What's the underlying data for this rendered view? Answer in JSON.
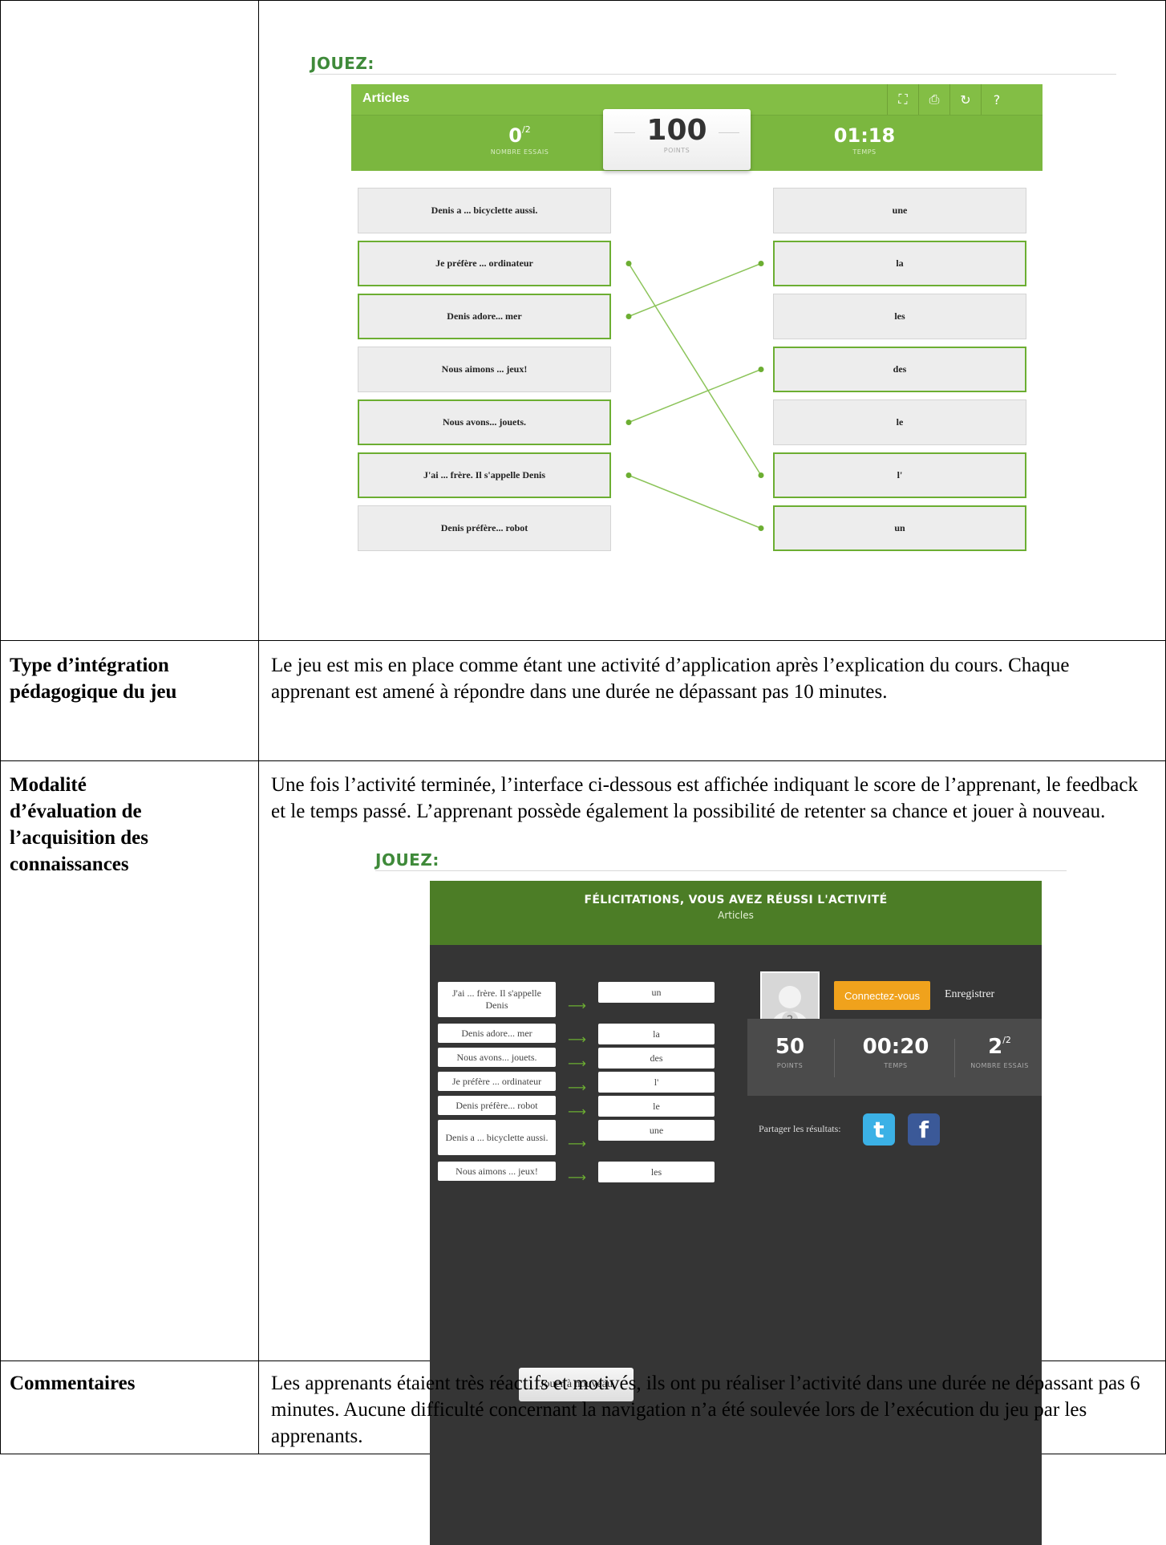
{
  "jouez_label": "JOUEZ:",
  "game": {
    "title": "Articles",
    "attempts_value": "0",
    "attempts_total": "/2",
    "attempts_caption": "NOMBRE ESSAIS",
    "points_value": "100",
    "points_caption": "POINTS",
    "time_value": "01:18",
    "time_caption": "TEMPS",
    "icons": [
      "fullscreen-icon",
      "print-icon",
      "refresh-icon",
      "help-icon"
    ],
    "left_items": [
      {
        "text": "Denis a ... bicyclette aussi.",
        "selected": false
      },
      {
        "text": "Je préfère ... ordinateur",
        "selected": true
      },
      {
        "text": "Denis adore... mer",
        "selected": true
      },
      {
        "text": "Nous aimons ... jeux!",
        "selected": false
      },
      {
        "text": "Nous avons... jouets.",
        "selected": true
      },
      {
        "text": "J'ai ... frère. Il s'appelle Denis",
        "selected": true
      },
      {
        "text": "Denis préfère... robot",
        "selected": false
      }
    ],
    "right_items": [
      {
        "text": "une",
        "selected": false
      },
      {
        "text": "la",
        "selected": true
      },
      {
        "text": "les",
        "selected": false
      },
      {
        "text": "des",
        "selected": true
      },
      {
        "text": "le",
        "selected": false
      },
      {
        "text": "l'",
        "selected": true
      },
      {
        "text": "un",
        "selected": true
      }
    ],
    "connections": [
      [
        1,
        5
      ],
      [
        2,
        1
      ],
      [
        4,
        3
      ],
      [
        5,
        6
      ]
    ],
    "accent_color": "#7bb73f"
  },
  "rows": [
    {
      "label": "Type d’intégration pédagogique du jeu",
      "text": "Le jeu est mis en place comme étant une activité d’application après l’explication du cours. Chaque apprenant est amené à répondre dans une durée ne dépassant pas 10 minutes."
    },
    {
      "label": "Modalité d’évaluation de l’acquisition des connaissances",
      "text": "Une fois l’activité terminée, l’interface ci-dessous est affichée indiquant le score de l’apprenant, le feedback et le temps passé. L’apprenant possède également la possibilité de retenter sa chance et jouer à nouveau."
    },
    {
      "label": "Commentaires",
      "text": "Les apprenants étaient très réactifs et motivés, ils ont pu réaliser l’activité dans une durée ne dépassant pas 6 minutes. Aucune difficulté concernant la navigation n’a été soulevée lors de l’exécution du jeu par les apprenants."
    }
  ],
  "results": {
    "title": "FÉLICITATIONS, VOUS AVEZ RÉUSSI L'ACTIVITÉ",
    "subtitle": "Articles",
    "pairs": [
      {
        "left": "J'ai ... frère. Il s'appelle Denis",
        "right": "un"
      },
      {
        "left": "Denis adore... mer",
        "right": "la"
      },
      {
        "left": "Nous avons... jouets.",
        "right": "des"
      },
      {
        "left": "Je préfère ... ordinateur",
        "right": "l'"
      },
      {
        "left": "Denis préfère... robot",
        "right": "le"
      },
      {
        "left": "Denis a ... bicyclette aussi.",
        "right": "une"
      },
      {
        "left": "Nous aimons ... jeux!",
        "right": "les"
      }
    ],
    "play_again": "Jouer à nouveau",
    "connect_label": "Connectez-vous",
    "register_label": "Enregistrer",
    "points_value": "50",
    "points_caption": "POINTS",
    "time_value": "00:20",
    "time_caption": "TEMPS",
    "attempts_value": "2",
    "attempts_total": "/2",
    "attempts_caption": "NOMBRE ESSAIS",
    "share_label": "Partager les résultats:",
    "twitter_glyph": "t",
    "facebook_glyph": "f"
  }
}
